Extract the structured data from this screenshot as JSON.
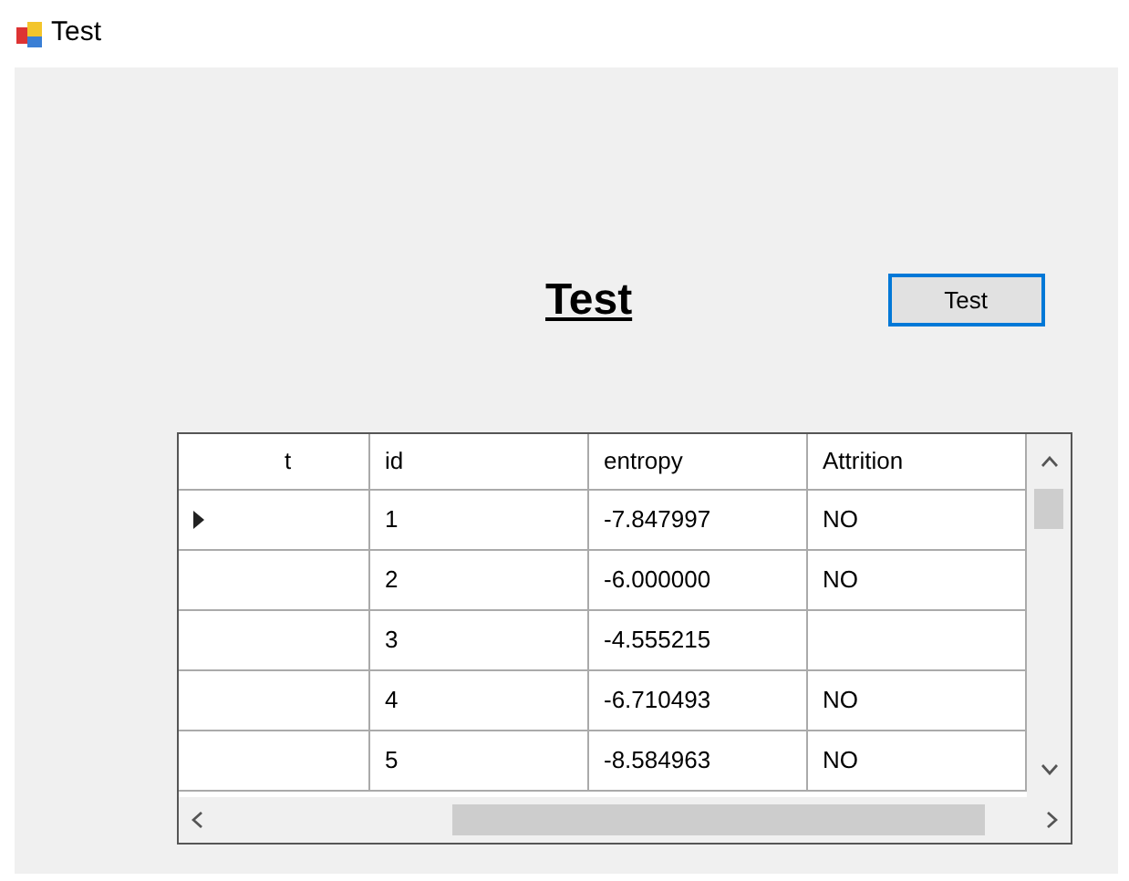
{
  "window": {
    "title": "Test"
  },
  "heading": "Test",
  "button": {
    "label": "Test"
  },
  "table": {
    "columns": [
      "t",
      "id",
      "entropy",
      "Attrition"
    ],
    "rows": [
      {
        "current": true,
        "cells": [
          "",
          "1",
          "-7.847997",
          "NO"
        ]
      },
      {
        "current": false,
        "cells": [
          "",
          "2",
          "-6.000000",
          "NO"
        ]
      },
      {
        "current": false,
        "cells": [
          "",
          "3",
          "-4.555215",
          ""
        ]
      },
      {
        "current": false,
        "cells": [
          "",
          "4",
          "-6.710493",
          "NO"
        ]
      },
      {
        "current": false,
        "cells": [
          "",
          "5",
          "-8.584963",
          "NO"
        ]
      }
    ]
  }
}
